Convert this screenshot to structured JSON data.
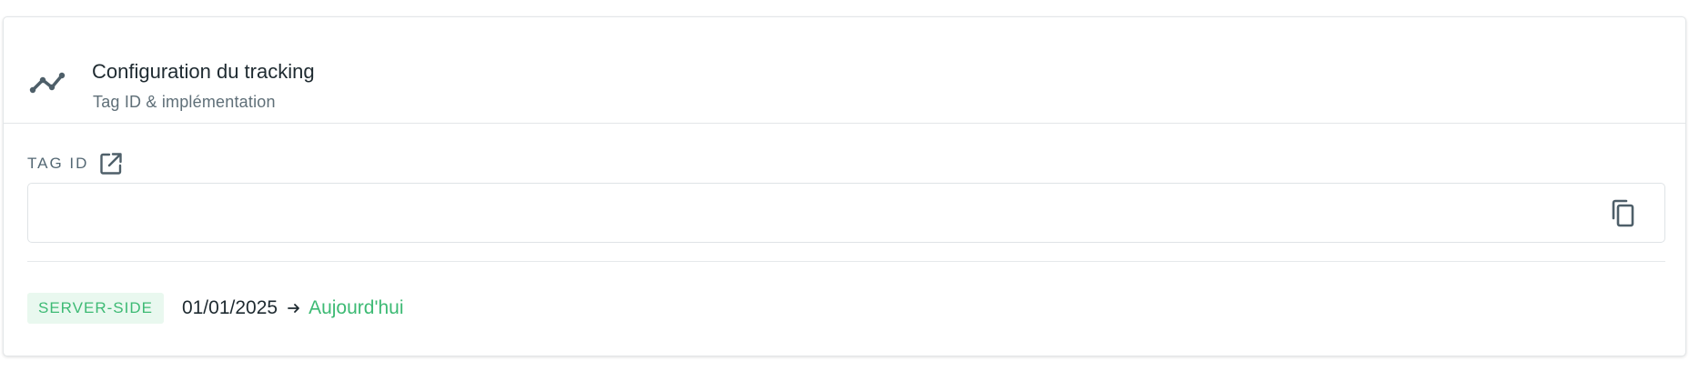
{
  "header": {
    "icon": "trend-line-icon",
    "title": "Configuration du tracking",
    "subtitle": "Tag ID & implémentation"
  },
  "tag_field": {
    "label": "TAG ID",
    "label_icon": "external-link-icon",
    "value": "",
    "placeholder": "",
    "copy_icon": "copy-icon"
  },
  "footer": {
    "badge": "SERVER-SIDE",
    "date_start": "01/01/2025",
    "arrow_icon": "arrow-right-icon",
    "date_end": "Aujourd'hui"
  },
  "colors": {
    "accent": "#3dba74",
    "badge_bg": "#e9f8ef",
    "icon": "#4e5f69",
    "text": "#1e2a30",
    "muted": "#5f6f78"
  }
}
